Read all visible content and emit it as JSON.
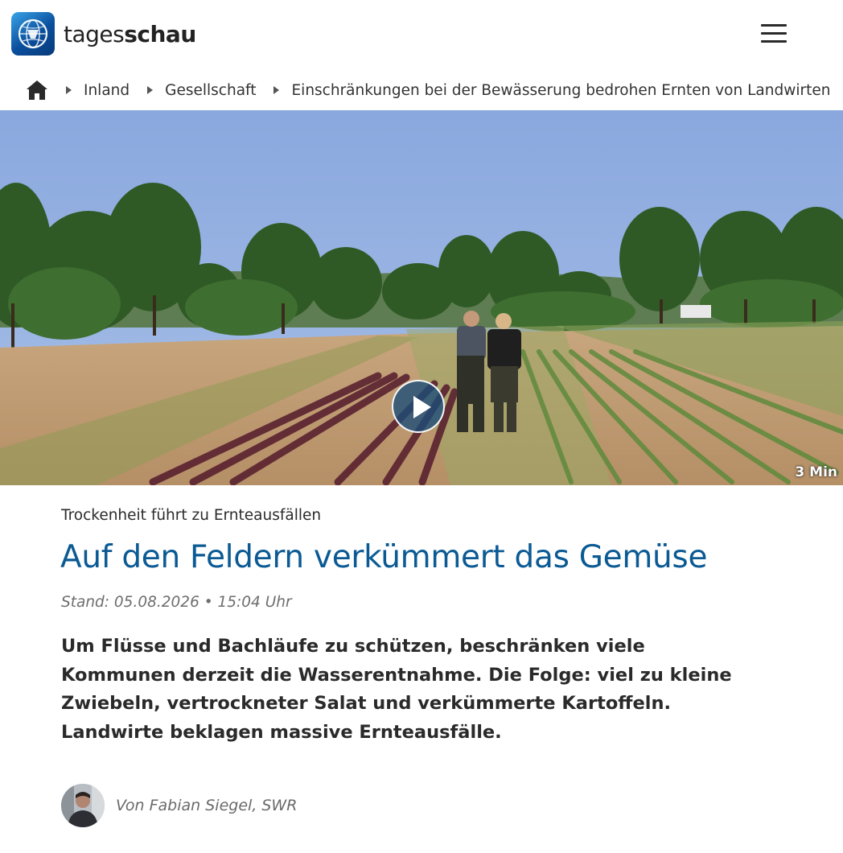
{
  "header": {
    "logo_text_light": "tages",
    "logo_text_bold": "schau",
    "menu_icon": "hamburger-menu-icon"
  },
  "breadcrumb": {
    "home_icon": "home-icon",
    "items": [
      {
        "label": "Inland"
      },
      {
        "label": "Gesellschaft"
      },
      {
        "label": "Einschränkungen bei der Bewässerung bedrohen Ernten von Landwirten"
      }
    ]
  },
  "video": {
    "duration": "3 Min",
    "play_icon": "play-icon"
  },
  "article": {
    "topline": "Trockenheit führt zu Ernteausfällen",
    "headline": "Auf den Feldern verkümmert das Gemüse",
    "meta": "Stand: 05.08.2026 • 15:04 Uhr",
    "teaser": "Um Flüsse und Bachläufe zu schützen, beschränken viele Kommunen derzeit die Wasserentnahme. Die Folge: viel zu kleine Zwiebeln, vertrockneter Salat und verkümmerte Kartoffeln. Landwirte beklagen massive Ernteausfälle.",
    "author": "Von Fabian Siegel, SWR"
  },
  "colors": {
    "headline": "#0b5a94",
    "logo_blue": "#0a4e9c"
  }
}
